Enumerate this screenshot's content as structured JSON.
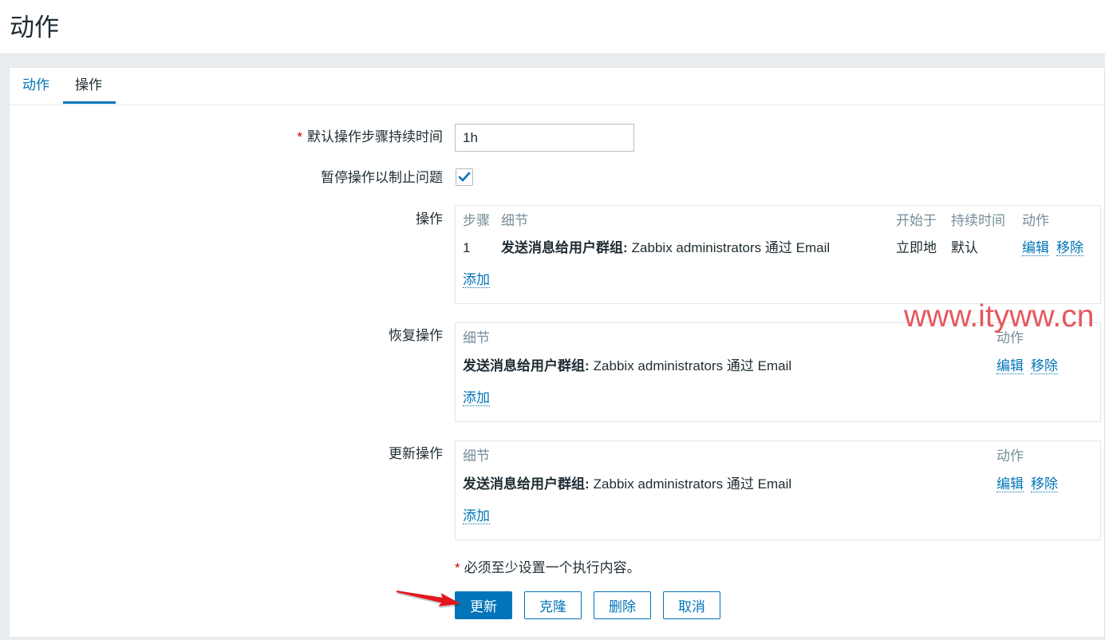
{
  "page": {
    "title": "动作"
  },
  "tabs": [
    {
      "label": "动作",
      "active": false
    },
    {
      "label": "操作",
      "active": true
    }
  ],
  "form": {
    "required_mark": "*",
    "default_step_duration": {
      "label": "默认操作步骤持续时间",
      "value": "1h"
    },
    "pause_suppressed": {
      "label": "暂停操作以制止问题",
      "checked": true
    },
    "operations": {
      "label": "操作",
      "headers": {
        "step": "步骤",
        "details": "细节",
        "start_in": "开始于",
        "duration": "持续时间",
        "action": "动作"
      },
      "rows": [
        {
          "step": "1",
          "detail_prefix": "发送消息给用户群组:",
          "detail_text": "Zabbix administrators 通过 Email",
          "start_in": "立即地",
          "duration": "默认",
          "edit": "编辑",
          "remove": "移除"
        }
      ],
      "add": "添加"
    },
    "recovery_operations": {
      "label": "恢复操作",
      "headers": {
        "details": "细节",
        "action": "动作"
      },
      "rows": [
        {
          "detail_prefix": "发送消息给用户群组:",
          "detail_text": "Zabbix administrators 通过 Email",
          "edit": "编辑",
          "remove": "移除"
        }
      ],
      "add": "添加"
    },
    "update_operations": {
      "label": "更新操作",
      "headers": {
        "details": "细节",
        "action": "动作"
      },
      "rows": [
        {
          "detail_prefix": "发送消息给用户群组:",
          "detail_text": "Zabbix administrators 通过 Email",
          "edit": "编辑",
          "remove": "移除"
        }
      ],
      "add": "添加"
    },
    "note": {
      "mark": "*",
      "text": "必须至少设置一个执行内容。"
    }
  },
  "buttons": {
    "update": "更新",
    "clone": "克隆",
    "delete": "删除",
    "cancel": "取消"
  },
  "watermark": "www.ityww.cn",
  "colors": {
    "link": "#0275b8",
    "text": "#1f2c33",
    "muted": "#768d99",
    "required": "#d40000",
    "primary_button": "#0275b8",
    "watermark": "#e4585e",
    "annotation_arrow": "#e3161d"
  }
}
